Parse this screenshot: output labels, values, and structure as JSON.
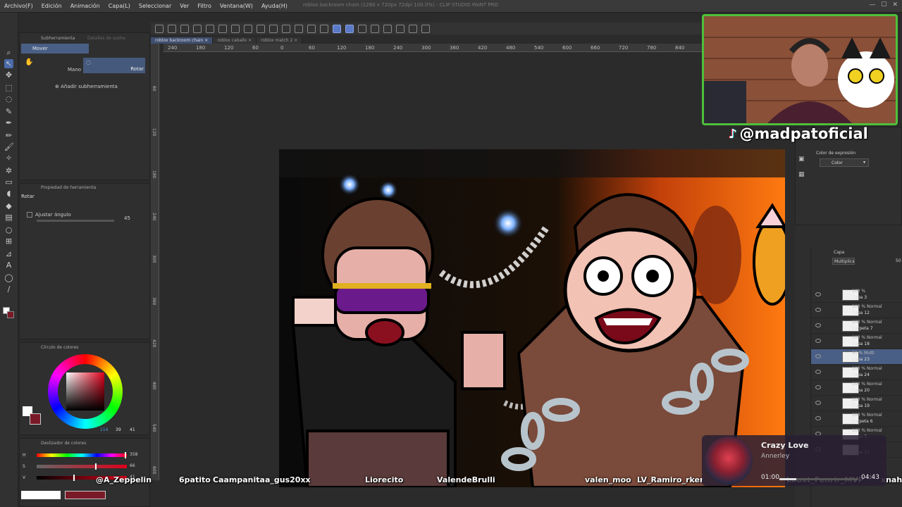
{
  "menu": [
    "Archivo(F)",
    "Edición",
    "Animación",
    "Capa(L)",
    "Seleccionar",
    "Ver",
    "Filtro",
    "Ventana(W)",
    "Ayuda(H)"
  ],
  "window_title": "roblox backroom chain (1280 x 720px 72dpi 100.0%) - CLIP STUDIO PAINT PRO",
  "doc_tabs": [
    "roblox backroom chain",
    "roblox caballo",
    "roblox match 2"
  ],
  "ruler_ticks": [
    "240",
    "180",
    "120",
    "60",
    "0",
    "60",
    "120",
    "180",
    "240",
    "300",
    "360",
    "420",
    "480",
    "540",
    "600",
    "660",
    "720",
    "780",
    "840"
  ],
  "vruler_ticks": [
    "60",
    "120",
    "180",
    "240",
    "300",
    "360",
    "420",
    "480",
    "540",
    "600"
  ],
  "subtool": {
    "tab_label": "Subherramienta",
    "tab2_label": "Detalles de subhe",
    "selected": "Mover",
    "mano_label": "Mano",
    "rotar_label": "Rotar",
    "add_label": "Añadir subherramienta"
  },
  "tool_property": {
    "tab_label": "Propiedad de herramienta",
    "tool_name": "Rotar",
    "ajustar_label": "Ajustar ángulo",
    "angle_value": "45"
  },
  "color_wheel": {
    "tab_label": "Círculo de colores",
    "h_value": "114",
    "s_value": "39",
    "v_value": "41"
  },
  "color_slider": {
    "tab_label": "Deslizador de colores",
    "h_label": "H",
    "s_label": "S",
    "v_label": "V",
    "h_value": "358",
    "s_value": "66",
    "v_value": "41",
    "h_fraction": 0.99,
    "s_fraction": 0.66,
    "v_fraction": 0.41
  },
  "color_expression": {
    "tab_label": "Color de expresión",
    "dropdown_value": "Color"
  },
  "layer_panel": {
    "tab_label": "Capa",
    "blend_mode": "Multiplicar",
    "opacity": "50",
    "layers": [
      {
        "pct": "100 %",
        "name": "Capa 3",
        "color": "#2e2e2e"
      },
      {
        "pct": "100 % Normal",
        "name": "Capa 12",
        "color": "#2e2e2e"
      },
      {
        "pct": "100 % Normal",
        "name": "Carpeta 7",
        "color": "#2e2e2e"
      },
      {
        "pct": "100 % Normal",
        "name": "Capa 18",
        "color": "#2e2e2e"
      },
      {
        "pct": "50 % Multi",
        "name": "Capa 23",
        "color": "#4a5f86"
      },
      {
        "pct": "100 % Normal",
        "name": "Capa 24",
        "color": "#2e2e2e"
      },
      {
        "pct": "100 % Normal",
        "name": "Capa 20",
        "color": "#2e2e2e"
      },
      {
        "pct": "100 % Normal",
        "name": "Capa 19",
        "color": "#2e2e2e"
      },
      {
        "pct": "100 % Normal",
        "name": "Carpeta 6",
        "color": "#2e2e2e"
      },
      {
        "pct": "100 % Normal",
        "name": "Capa 3",
        "color": "#2e2e2e"
      },
      {
        "pct": "",
        "name": "Capa 11",
        "color": "#2e2e2e"
      }
    ]
  },
  "stream": {
    "handle": "@madpatoficial",
    "chat_names": [
      "@A_Zeppelin",
      "6patito",
      "Caampanitaa_gus20xx",
      "Liorecito",
      "ValendeBrulli",
      "valen_moo",
      "LV_Ramiro_rker",
      "Leoxt_Fenrir_MVP",
      "xnahu"
    ],
    "song_title": "Crazy Love",
    "song_artist": "Annerley",
    "time_elapsed": "01:00",
    "time_total": "04:43",
    "progress_fraction": 0.21
  },
  "colors": {
    "accent": "#4a6aa8",
    "webcam_border": "#4ec03a",
    "foreground_color": "#7a1a28",
    "background_color": "#ffffff"
  }
}
